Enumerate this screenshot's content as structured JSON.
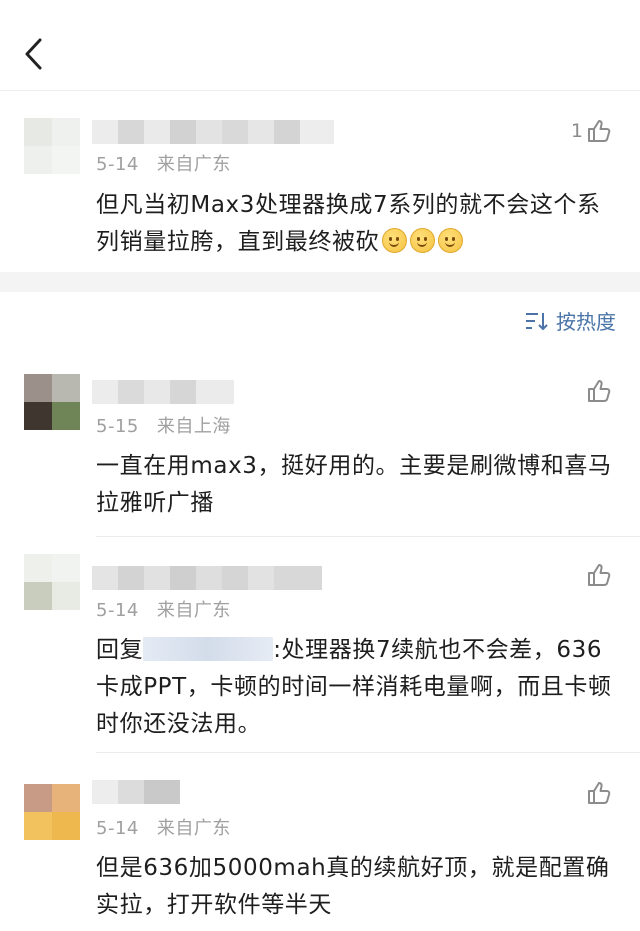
{
  "topbar": {
    "back_icon": "chevron-left-icon"
  },
  "comments": [
    {
      "date": "5-14",
      "location": "来自广东",
      "likes": "1",
      "text": "但凡当初Max3处理器换成7系列的就不会这个系列销量拉胯，直到最终被砍",
      "emoji_count": 3
    },
    {
      "date": "5-15",
      "location": "来自上海",
      "likes": "",
      "text": "一直在用max3，挺好用的。主要是刷微博和喜马拉雅听广播"
    },
    {
      "date": "5-14",
      "location": "来自广东",
      "likes": "",
      "reply_prefix": "回复",
      "text": ":处理器换7续航也不会差，636卡成PPT，卡顿的时间一样消耗电量啊，而且卡顿时你还没法用。"
    },
    {
      "date": "5-14",
      "location": "来自广东",
      "likes": "",
      "text": "但是636加5000mah真的续航好顶，就是配置确实拉，打开软件等半天"
    }
  ],
  "sort": {
    "label": "按热度",
    "icon": "sort-icon"
  },
  "colors": {
    "link": "#4a74a8",
    "meta": "#a0a0a0",
    "text": "#1e1e1e",
    "divider": "#ececec"
  }
}
